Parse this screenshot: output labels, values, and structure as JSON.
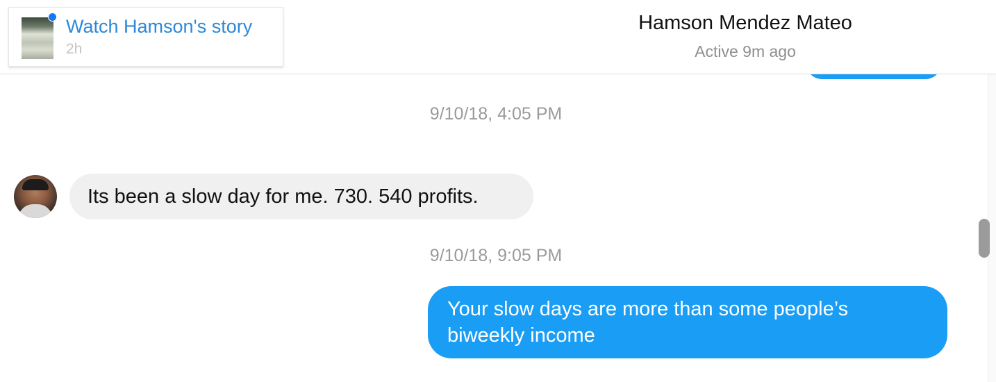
{
  "header": {
    "story": {
      "title": "Watch Hamson's story",
      "time": "2h",
      "thumbnail_icon": "story-thumbnail",
      "unread_dot_color": "#1877f2"
    },
    "contact": {
      "name": "Hamson Mendez Mateo",
      "status": "Active 9m ago"
    }
  },
  "conversation": {
    "timestamps": [
      "9/10/18, 4:05 PM",
      "9/10/18, 9:05 PM"
    ],
    "incoming": {
      "text": "Its been a slow day for me. 730. 540 profits.",
      "avatar_icon": "contact-avatar"
    },
    "outgoing": {
      "text": "Your slow days are more than some people’s biweekly income"
    },
    "colors": {
      "outgoing_bubble": "#1a9df4",
      "incoming_bubble": "#f0f0f0",
      "link": "#2d88d7"
    }
  }
}
